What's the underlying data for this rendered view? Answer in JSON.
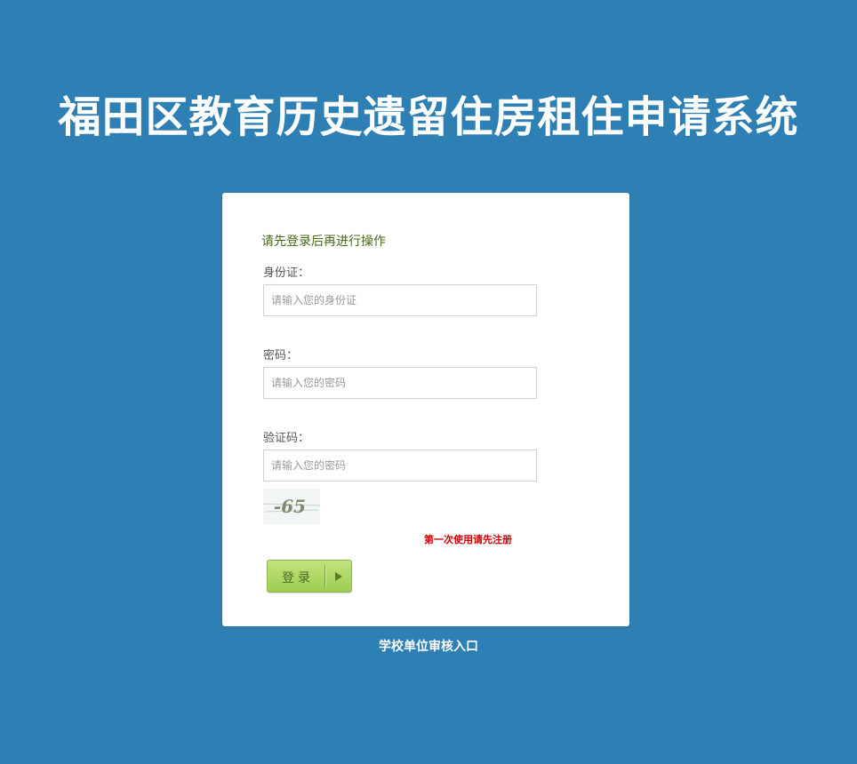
{
  "page": {
    "title": "福田区教育历史遗留住房租住申请系统"
  },
  "login": {
    "notice": "请先登录后再进行操作",
    "id_label": "身份证：",
    "id_placeholder": "请输入您的身份证",
    "password_label": "密码：",
    "password_placeholder": "请输入您的密码",
    "captcha_label": "验证码：",
    "captcha_placeholder": "请输入您的密码",
    "captcha_text": "-65",
    "register_link": "第一次使用请先注册",
    "login_button": "登录"
  },
  "footer": {
    "school_link": "学校单位审核入口"
  },
  "colors": {
    "background": "#2e7fb3",
    "button": "#a8d25e",
    "register_link": "#cc0000"
  }
}
